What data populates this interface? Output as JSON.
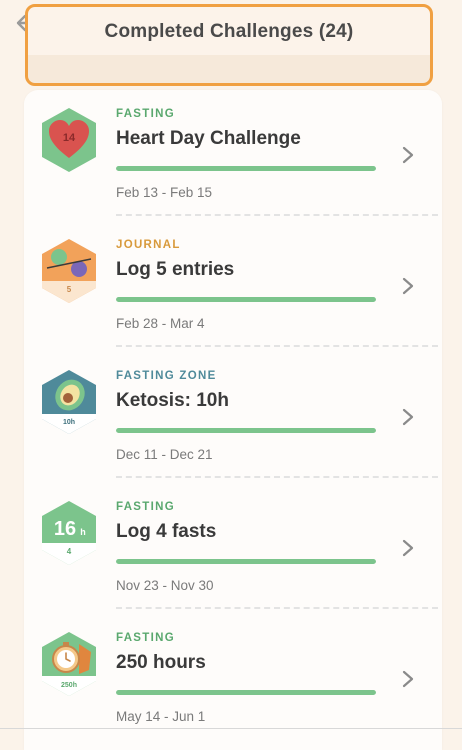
{
  "header": {
    "title": "Completed Challenges (24)",
    "back_icon": "back-arrow-icon"
  },
  "colors": {
    "fasting": "#5aa86e",
    "journal": "#d89a3c",
    "fasting_zone": "#4f8a9a",
    "highlight_border": "#f0a042",
    "progress": "#7cc48c"
  },
  "challenges": [
    {
      "category": "FASTING",
      "name": "Heart Day Challenge",
      "dates": "Feb 13 - Feb 15",
      "progress": 1.0,
      "badge": "heart-day-badge-icon",
      "badge_text": "14"
    },
    {
      "category": "JOURNAL",
      "name": "Log 5 entries",
      "dates": "Feb 28 - Mar 4",
      "progress": 1.0,
      "badge": "journal-badge-icon",
      "badge_text": "5"
    },
    {
      "category": "FASTING ZONE",
      "name": "Ketosis: 10h",
      "dates": "Dec 11 - Dec 21",
      "progress": 1.0,
      "badge": "avocado-badge-icon",
      "badge_text": "10h"
    },
    {
      "category": "FASTING",
      "name": "Log 4 fasts",
      "dates": "Nov 23 - Nov 30",
      "progress": 1.0,
      "badge": "16h-badge-icon",
      "badge_text": "16",
      "badge_sub": "h",
      "badge_text2": "4"
    },
    {
      "category": "FASTING",
      "name": "250 hours",
      "dates": "May 14 - Jun 1",
      "progress": 1.0,
      "badge": "stopwatch-badge-icon",
      "badge_text": "250h"
    }
  ]
}
